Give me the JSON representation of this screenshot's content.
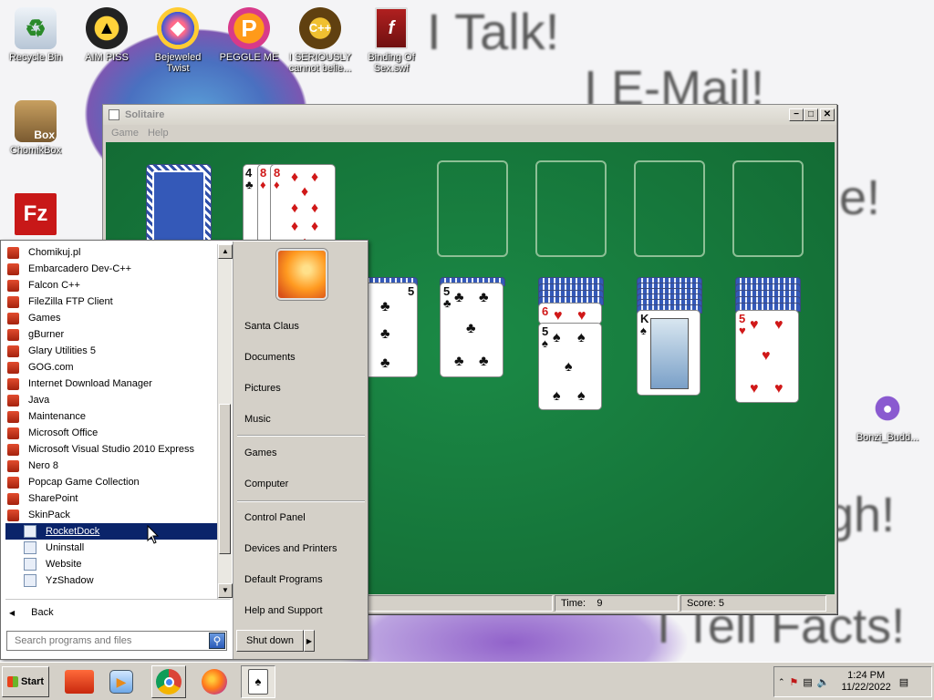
{
  "desktop": {
    "background_text": [
      "I Talk!",
      "I E-Mail!",
      "e!",
      "gh!",
      "I Tell Facts!"
    ],
    "icons": [
      {
        "label": "Recycle Bin",
        "icon": "recycle-bin-icon"
      },
      {
        "label": "AIM PISS",
        "icon": "aim-icon"
      },
      {
        "label": "Bejeweled Twist",
        "icon": "bejeweled-icon"
      },
      {
        "label": "PEGGLE ME",
        "icon": "peggle-icon"
      },
      {
        "label": "I SERIOUSLY cannot belie...",
        "icon": "shortcut-icon"
      },
      {
        "label": "Binding Of Sex.swf",
        "icon": "flash-file-icon"
      },
      {
        "label": "ChomikBox",
        "icon": "chomikbox-icon"
      },
      {
        "label": "",
        "icon": "filezilla-icon"
      },
      {
        "label": "Bonzi_Budd...",
        "icon": "bonzi-buddy-icon"
      }
    ]
  },
  "solitaire": {
    "title": "Solitaire",
    "menu": [
      "Game",
      "Help"
    ],
    "time_label": "Time:",
    "time_value": "9",
    "score_label": "Score: 5",
    "cards": {
      "waste_ranks": [
        "4",
        "8",
        "8"
      ],
      "tableau_ranks": [
        "5",
        "6",
        "5",
        "K",
        "5"
      ]
    }
  },
  "start_menu": {
    "programs": [
      {
        "label": "Chomikuj.pl",
        "type": "folder"
      },
      {
        "label": "Embarcadero Dev-C++",
        "type": "folder"
      },
      {
        "label": "Falcon C++",
        "type": "folder"
      },
      {
        "label": "FileZilla FTP Client",
        "type": "folder"
      },
      {
        "label": "Games",
        "type": "folder"
      },
      {
        "label": "gBurner",
        "type": "folder"
      },
      {
        "label": "Glary Utilities 5",
        "type": "folder"
      },
      {
        "label": "GOG.com",
        "type": "folder"
      },
      {
        "label": "Internet Download Manager",
        "type": "folder"
      },
      {
        "label": "Java",
        "type": "folder"
      },
      {
        "label": "Maintenance",
        "type": "folder"
      },
      {
        "label": "Microsoft Office",
        "type": "folder"
      },
      {
        "label": "Microsoft Visual Studio 2010 Express",
        "type": "folder"
      },
      {
        "label": "Nero 8",
        "type": "folder"
      },
      {
        "label": "Popcap Game Collection",
        "type": "folder"
      },
      {
        "label": "SharePoint",
        "type": "folder"
      },
      {
        "label": "SkinPack",
        "type": "folder"
      },
      {
        "label": "RocketDock",
        "type": "sub",
        "selected": true
      },
      {
        "label": "Uninstall",
        "type": "sub"
      },
      {
        "label": "Website",
        "type": "sub"
      },
      {
        "label": "YzShadow",
        "type": "sub"
      }
    ],
    "back_label": "Back",
    "search_placeholder": "Search programs and files",
    "shutdown_label": "Shut down",
    "right_items": [
      "Santa Claus",
      "Documents",
      "Pictures",
      "Music",
      "Games",
      "Computer",
      "Control Panel",
      "Devices and Printers",
      "Default Programs",
      "Help and Support"
    ]
  },
  "taskbar": {
    "start_label": "Start",
    "clock_time": "1:24 PM",
    "clock_date": "11/22/2022"
  },
  "colors": {
    "felt": "#136b34",
    "selection": "#0a246a",
    "window_face": "#d4d0c8"
  }
}
